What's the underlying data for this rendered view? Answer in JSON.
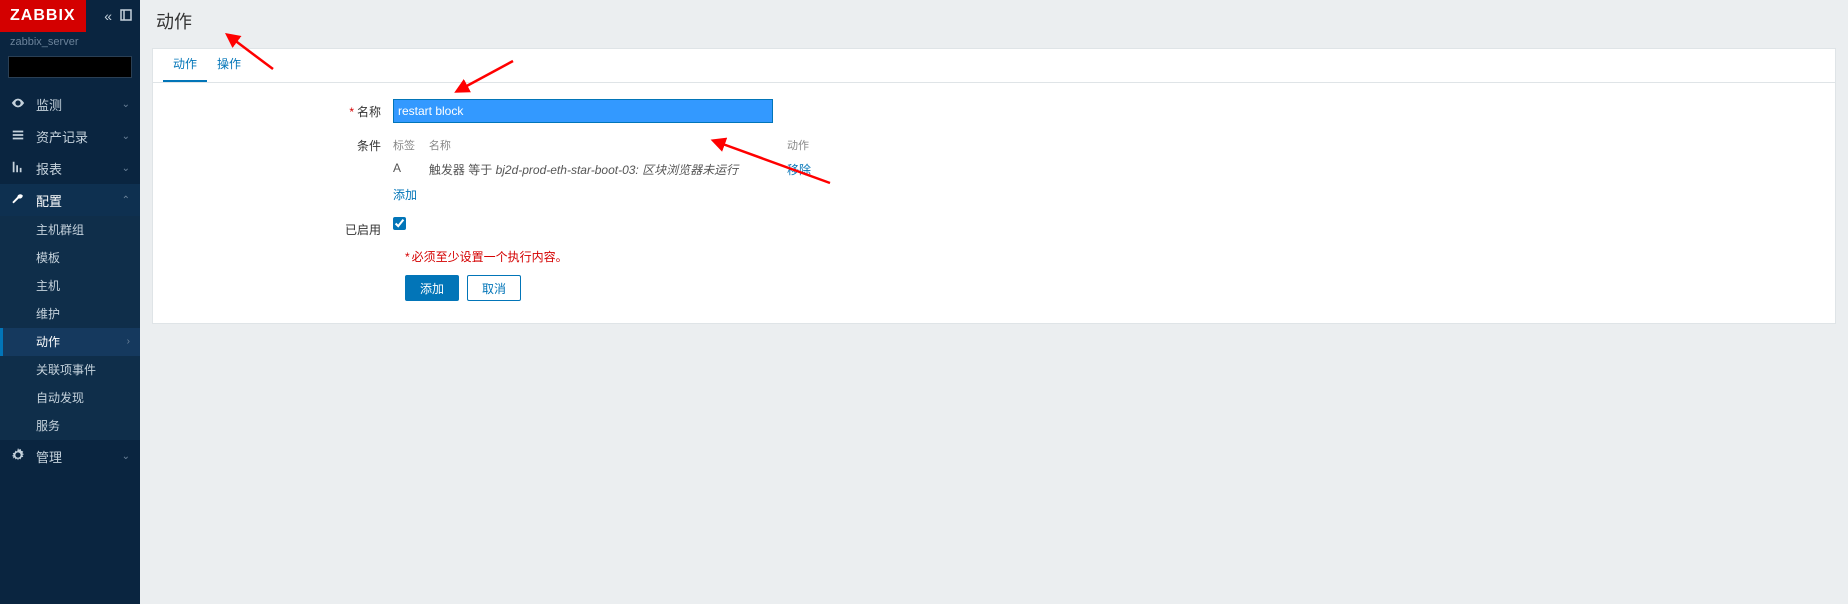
{
  "brand": "ZABBIX",
  "server_name": "zabbix_server",
  "search_placeholder": "",
  "nav": {
    "items": [
      {
        "icon": "eye",
        "label": "监测",
        "expanded": false
      },
      {
        "icon": "list",
        "label": "资产记录",
        "expanded": false
      },
      {
        "icon": "chart",
        "label": "报表",
        "expanded": false
      },
      {
        "icon": "wrench",
        "label": "配置",
        "expanded": true,
        "children": [
          {
            "label": "主机群组"
          },
          {
            "label": "模板"
          },
          {
            "label": "主机"
          },
          {
            "label": "维护"
          },
          {
            "label": "动作",
            "active": true,
            "has_sub": true
          },
          {
            "label": "关联项事件"
          },
          {
            "label": "自动发现"
          },
          {
            "label": "服务"
          }
        ]
      },
      {
        "icon": "gear",
        "label": "管理",
        "expanded": false
      }
    ]
  },
  "page_title": "动作",
  "tabs": [
    {
      "label": "动作",
      "active": true
    },
    {
      "label": "操作",
      "active": false
    }
  ],
  "form": {
    "name_label": "名称",
    "name_value": "restart block",
    "cond_label": "条件",
    "cond_headers": {
      "tag": "标签",
      "name": "名称",
      "action": "动作"
    },
    "conditions": [
      {
        "tag": "A",
        "prefix": "触发器 等于 ",
        "italic": "bj2d-prod-eth-star-boot-03: 区块浏览器未运行",
        "remove": "移除"
      }
    ],
    "add_link": "添加",
    "enabled_label": "已启用",
    "enabled": true,
    "error_msg": "必须至少设置一个执行内容。",
    "submit_btn": "添加",
    "cancel_btn": "取消"
  }
}
